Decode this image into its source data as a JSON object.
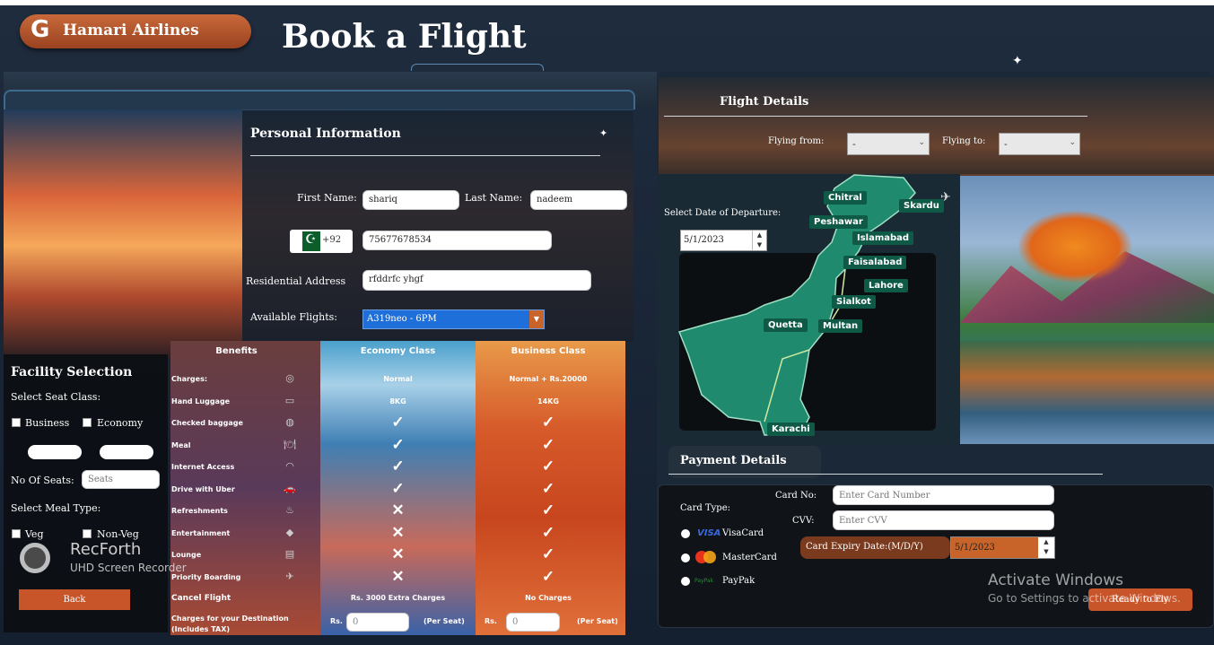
{
  "header": {
    "brand": "Hamari Airlines",
    "title": "Book a Flight"
  },
  "personal": {
    "heading": "Personal Information",
    "first_name_label": "First Name:",
    "first_name_value": "shariq",
    "last_name_label": "Last Name:",
    "last_name_value": "nadeem",
    "country_code": "+92",
    "phone_value": "75677678534",
    "address_label": "Residential Address",
    "address_value": "rfddrfc yhgf",
    "flights_label": "Available Flights:",
    "flights_value": "A319neo - 6PM"
  },
  "facility": {
    "heading": "Facility Selection",
    "seat_class_label": "Select Seat Class:",
    "business_label": "Business",
    "economy_label": "Economy",
    "seats_label": "No Of Seats:",
    "seats_placeholder": "Seats",
    "meal_label": "Select Meal Type:",
    "veg_label": "Veg",
    "nonveg_label": "Non-Veg",
    "back_label": "Back"
  },
  "benefits": {
    "headers": [
      "Benefits",
      "Economy Class",
      "Business Class"
    ],
    "rows": [
      {
        "label": "Charges:",
        "icon": "coins-icon",
        "economy": "Normal",
        "business": "Normal + Rs.20000"
      },
      {
        "label": "Hand Luggage",
        "icon": "briefcase-icon",
        "economy": "8KG",
        "business": "14KG"
      },
      {
        "label": "Checked baggage",
        "icon": "suitcase-icon",
        "economy": "check",
        "business": "check"
      },
      {
        "label": "Meal",
        "icon": "meal-icon",
        "economy": "check",
        "business": "check"
      },
      {
        "label": "Internet Access",
        "icon": "wifi-icon",
        "economy": "check",
        "business": "check"
      },
      {
        "label": "Drive with Uber",
        "icon": "car-icon",
        "economy": "check",
        "business": "check"
      },
      {
        "label": "Refreshments",
        "icon": "drinks-icon",
        "economy": "cross",
        "business": "check"
      },
      {
        "label": "Entertainment",
        "icon": "popcorn-icon",
        "economy": "cross",
        "business": "check"
      },
      {
        "label": "Lounge",
        "icon": "lounge-icon",
        "economy": "cross",
        "business": "check"
      },
      {
        "label": "Priority Boarding",
        "icon": "plane-icon",
        "economy": "cross",
        "business": "check"
      }
    ],
    "cancel_label": "Cancel Flight",
    "cancel_economy": "Rs. 3000 Extra Charges",
    "cancel_business": "No Charges",
    "dest_label": "Charges for your Destination (Includes TAX)",
    "rs": "Rs.",
    "economy_charge": "0",
    "business_charge": "0",
    "per_seat": "(Per Seat)"
  },
  "flight": {
    "heading": "Flight Details",
    "from_label": "Flying from:",
    "from_value": "-",
    "to_label": "Flying to:",
    "to_value": "-",
    "date_label": "Select Date of Departure:",
    "date_value": "5/1/2023",
    "cities": [
      "Chitral",
      "Skardu",
      "Peshawar",
      "Islamabad",
      "Faisalabad",
      "Lahore",
      "Sialkot",
      "Quetta",
      "Multan",
      "Karachi"
    ]
  },
  "payment": {
    "heading": "Payment Details",
    "card_type_label": "Card Type:",
    "card_no_label": "Card No:",
    "card_no_placeholder": "Enter Card Number",
    "cvv_label": "CVV:",
    "cvv_placeholder": "Enter CVV",
    "expiry_label": "Card Expiry Date:(M/D/Y)",
    "expiry_value": "5/1/2023",
    "visa_label": "VisaCard",
    "visa_logo": "VISA",
    "master_label": "MasterCard",
    "paypak_label": "PayPak",
    "paypak_logo": "PayPak",
    "submit_label": "Ready to Fly"
  },
  "overlays": {
    "recorder_title": "RecForth",
    "recorder_sub": "UHD Screen Recorder",
    "activate_title": "Activate Windows",
    "activate_sub": "Go to Settings to activate Windows."
  },
  "colors": {
    "accent_orange": "#c8542a",
    "dropdown_blue": "#1e6fd9",
    "map_green": "#1f8a6e"
  }
}
